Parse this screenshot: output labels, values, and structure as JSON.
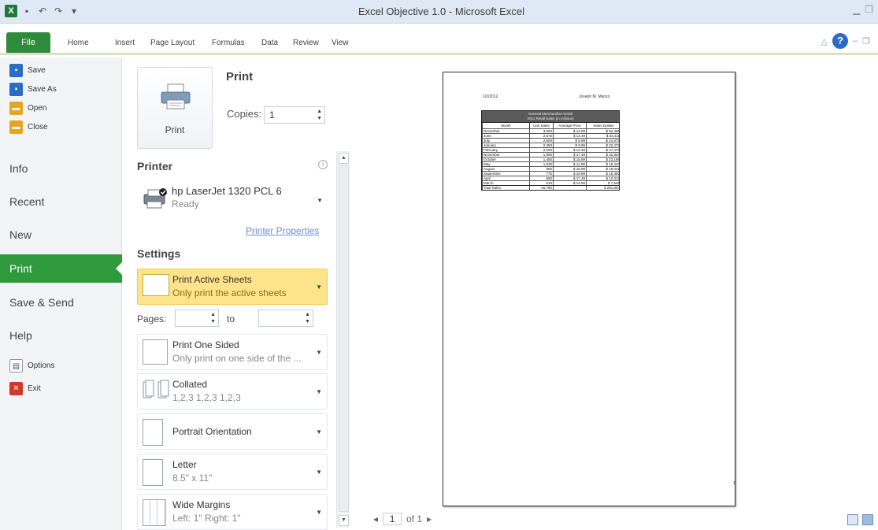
{
  "window": {
    "title": "Excel Objective 1.0 - Microsoft Excel"
  },
  "ribbon": {
    "file_tab": "File",
    "tabs": [
      "Home",
      "Insert",
      "Page Layout",
      "Formulas",
      "Data",
      "Review",
      "View"
    ]
  },
  "nav": {
    "small_items": [
      {
        "label": "Save",
        "icon": "save-icon",
        "color": "#2b6cc4"
      },
      {
        "label": "Save As",
        "icon": "save-as-icon",
        "color": "#2b6cc4"
      },
      {
        "label": "Open",
        "icon": "open-folder-icon",
        "color": "#e3a624"
      },
      {
        "label": "Close",
        "icon": "close-folder-icon",
        "color": "#e3a624"
      }
    ],
    "large_items": [
      "Info",
      "Recent",
      "New",
      "Print",
      "Save & Send",
      "Help"
    ],
    "active": "Print",
    "bottom_items": [
      {
        "label": "Options",
        "icon": "options-icon"
      },
      {
        "label": "Exit",
        "icon": "exit-icon"
      }
    ]
  },
  "print_panel": {
    "heading": "Print",
    "print_button_label": "Print",
    "copies_label": "Copies:",
    "copies_value": "1",
    "printer_section": "Printer",
    "printer_name": "hp LaserJet 1320 PCL 6",
    "printer_status": "Ready",
    "printer_properties_link": "Printer Properties",
    "settings_section": "Settings",
    "what_to_print": {
      "title": "Print Active Sheets",
      "subtitle": "Only print the active sheets"
    },
    "pages_label": "Pages:",
    "to_label": "to",
    "sided": {
      "title": "Print One Sided",
      "subtitle": "Only print on one side of the ..."
    },
    "collation": {
      "title": "Collated",
      "subtitle": "1,2,3   1,2,3   1,2,3"
    },
    "orientation": {
      "title": "Portrait Orientation"
    },
    "paper": {
      "title": "Letter",
      "subtitle": "8.5\" x 11\""
    },
    "margins": {
      "title": "Wide Margins",
      "subtitle": "Left: 1\"   Right: 1\""
    }
  },
  "preview": {
    "header_left": "1/2/2012",
    "header_right": "Joseph M. Manzo",
    "page_number": "1",
    "pager": {
      "current": "1",
      "of_label": "of 1"
    },
    "sheet": {
      "title_line1": "General Merchandise World",
      "title_line2": "2011 Retail Sales (in millions)",
      "headers": [
        "Month",
        "Unit Sales",
        "Average Price",
        "Sales Dollars"
      ],
      "rows": [
        [
          "December",
          "3,500",
          "$ 14.99",
          "$ 52,465"
        ],
        [
          "June",
          "2,675",
          "$ 12.49",
          "$ 33,411"
        ],
        [
          "July",
          "2,500",
          "$ 9.99",
          "$ 24,975"
        ],
        [
          "January",
          "2,250",
          "$ 9.99",
          "$ 22,478"
        ],
        [
          "February",
          "2,200",
          "$ 12.49",
          "$ 27,478"
        ],
        [
          "November",
          "1,850",
          "$ 17.49",
          "$ 32,357"
        ],
        [
          "October",
          "1,450",
          "$ 15.99",
          "$ 23,186"
        ],
        [
          "May",
          "1,030",
          "$ 14.99",
          "$ 15,440"
        ],
        [
          "August",
          "950",
          "$ 18.99",
          "$ 18,041"
        ],
        [
          "September",
          "775",
          "$ 19.99",
          "$ 15,492"
        ],
        [
          "April",
          "590",
          "$ 17.49",
          "$ 10,319"
        ],
        [
          "March",
          "510",
          "$ 14.99",
          "$ 7,645"
        ]
      ],
      "total_label": "Total Sales",
      "total_units": "20,780",
      "total_dollars": "$ 281,884"
    }
  },
  "colors": {
    "accent": "#2f9a3c",
    "highlight": "#fde48a",
    "link": "#6b8fc4"
  }
}
